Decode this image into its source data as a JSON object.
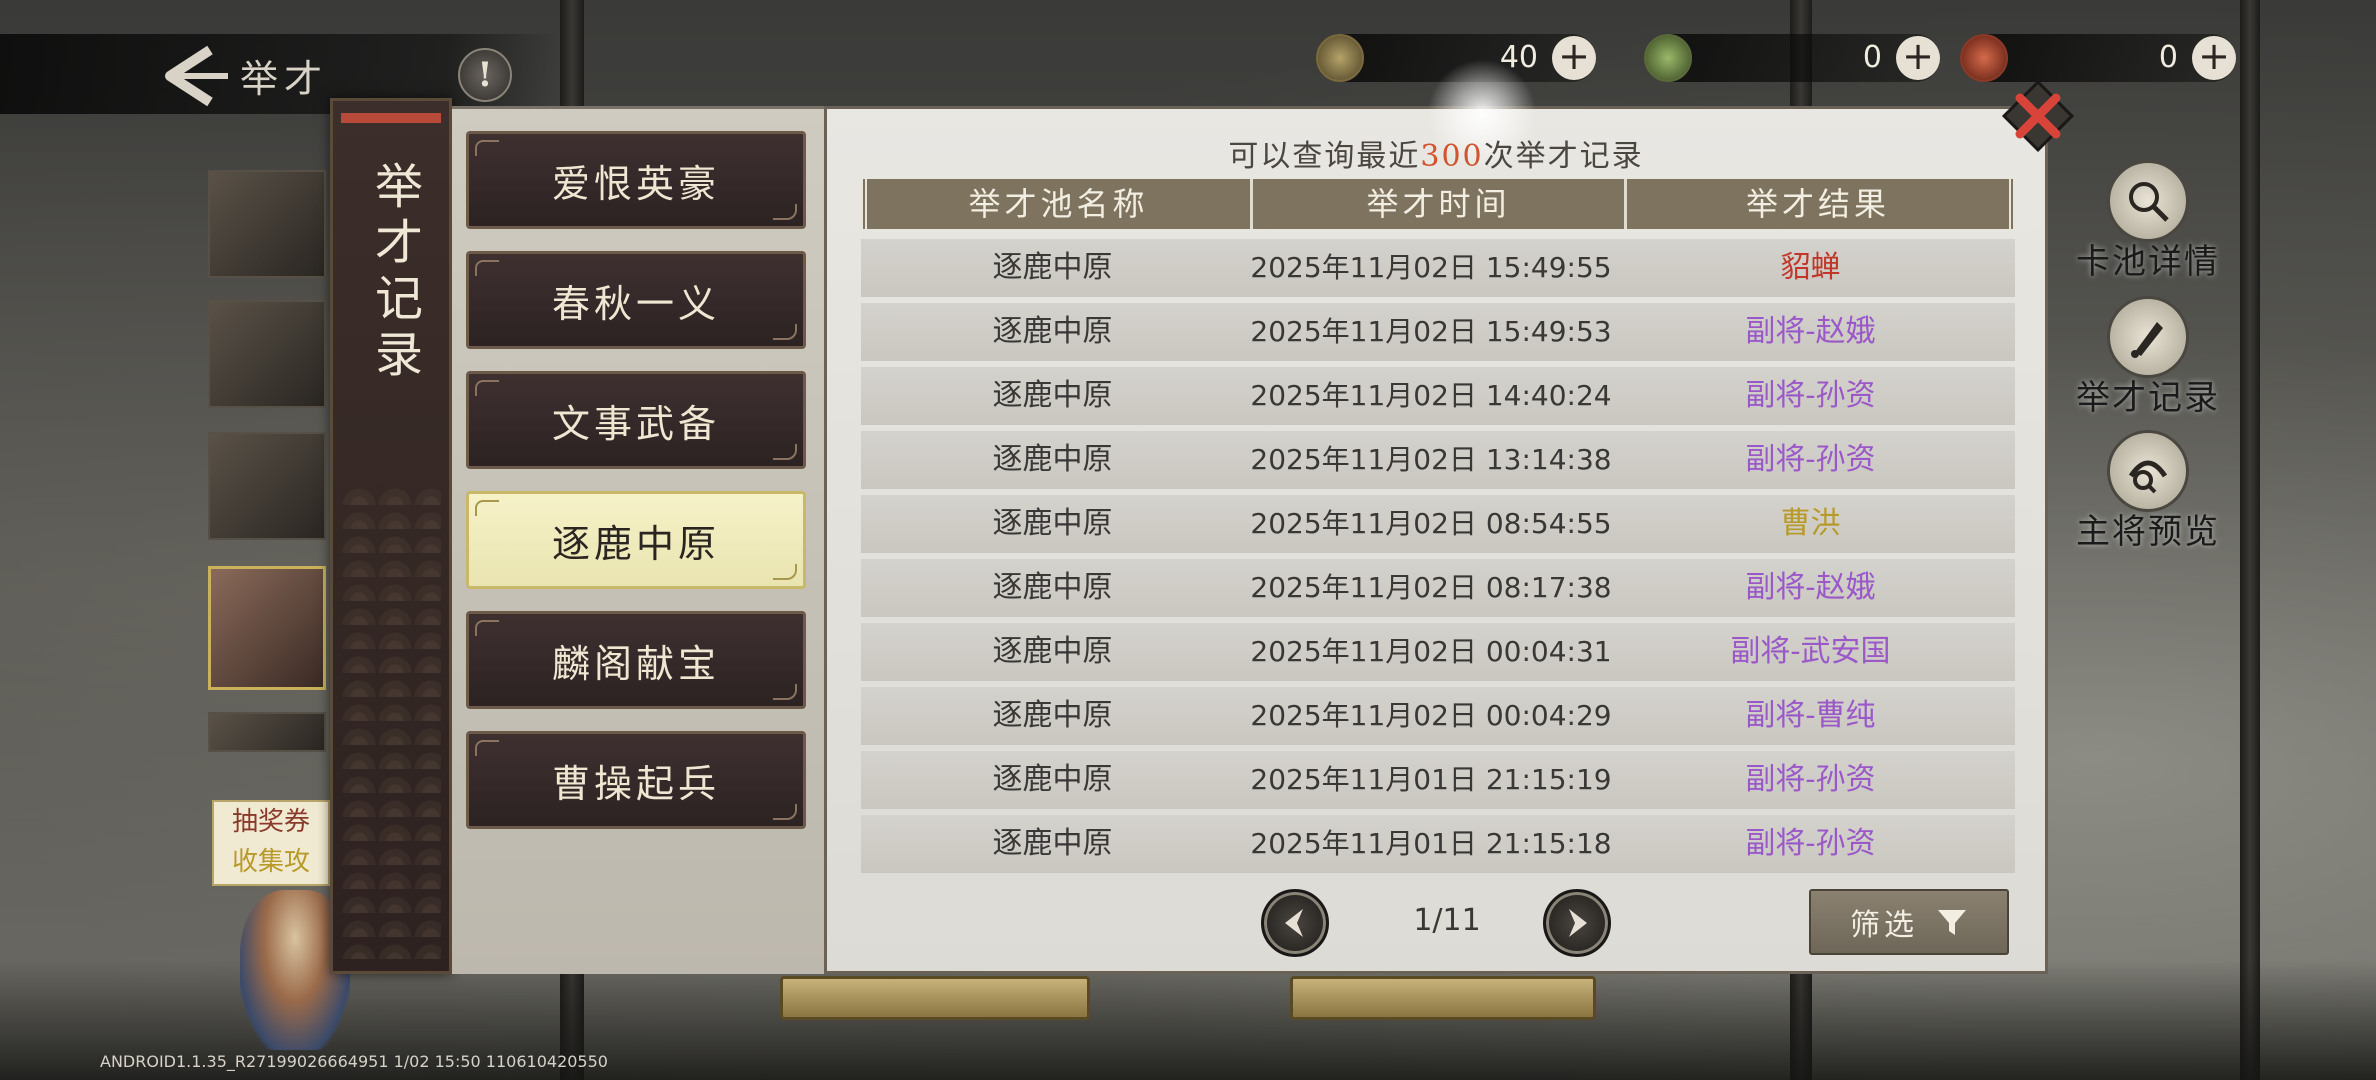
{
  "header": {
    "back_label": "举才",
    "info_icon": "!"
  },
  "currencies": [
    {
      "icon": "coin-icon",
      "value": "40"
    },
    {
      "icon": "jade-icon",
      "value": "0"
    },
    {
      "icon": "token-icon",
      "value": "0"
    }
  ],
  "side_menu": [
    {
      "label": "卡池详情",
      "icon": "magnifier-icon"
    },
    {
      "label": "举才记录",
      "icon": "brush-icon"
    },
    {
      "label": "主将预览",
      "icon": "preview-icon"
    }
  ],
  "background": {
    "ticket_text_1": "抽奖券",
    "ticket_text_2": "收集攻"
  },
  "dialog": {
    "title": "举才记录",
    "note_prefix": "可以查询最近",
    "note_number": "300",
    "note_suffix": "次举才记录",
    "pools": [
      {
        "label": "爱恨英豪",
        "active": false
      },
      {
        "label": "春秋一义",
        "active": false
      },
      {
        "label": "文事武备",
        "active": false
      },
      {
        "label": "逐鹿中原",
        "active": true
      },
      {
        "label": "麟阁献宝",
        "active": false
      },
      {
        "label": "曹操起兵",
        "active": false
      }
    ],
    "table": {
      "headers": [
        "举才池名称",
        "举才时间",
        "举才结果"
      ],
      "rows": [
        {
          "pool": "逐鹿中原",
          "time": "2025年11月02日 15:49:55",
          "result": "貂蝉",
          "quality": "red"
        },
        {
          "pool": "逐鹿中原",
          "time": "2025年11月02日 15:49:53",
          "result": "副将-赵娥",
          "quality": "purple"
        },
        {
          "pool": "逐鹿中原",
          "time": "2025年11月02日 14:40:24",
          "result": "副将-孙资",
          "quality": "purple"
        },
        {
          "pool": "逐鹿中原",
          "time": "2025年11月02日 13:14:38",
          "result": "副将-孙资",
          "quality": "purple"
        },
        {
          "pool": "逐鹿中原",
          "time": "2025年11月02日 08:54:55",
          "result": "曹洪",
          "quality": "gold"
        },
        {
          "pool": "逐鹿中原",
          "time": "2025年11月02日 08:17:38",
          "result": "副将-赵娥",
          "quality": "purple"
        },
        {
          "pool": "逐鹿中原",
          "time": "2025年11月02日 00:04:31",
          "result": "副将-武安国",
          "quality": "purple"
        },
        {
          "pool": "逐鹿中原",
          "time": "2025年11月02日 00:04:29",
          "result": "副将-曹纯",
          "quality": "purple"
        },
        {
          "pool": "逐鹿中原",
          "time": "2025年11月01日 21:15:19",
          "result": "副将-孙资",
          "quality": "purple"
        },
        {
          "pool": "逐鹿中原",
          "time": "2025年11月01日 21:15:18",
          "result": "副将-孙资",
          "quality": "purple"
        }
      ]
    },
    "pager": {
      "text": "1/11"
    },
    "filter_label": "筛选"
  },
  "colors": {
    "quality_red": "#c2362a",
    "quality_purple": "#9a58c8",
    "quality_gold": "#b89a2a",
    "note_highlight": "#d0542e"
  },
  "version": "ANDROID1.1.35_R27199026664951 1/02 15:50 110610420550"
}
